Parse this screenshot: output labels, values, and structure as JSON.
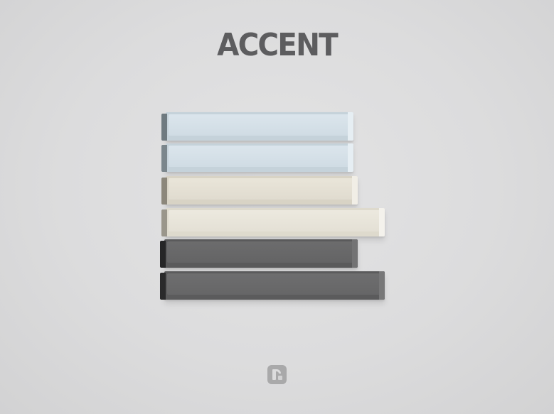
{
  "title": "ACCENT",
  "keycaps": [
    {
      "name": "light-blue-spacebar-1",
      "color": "#d0dce4"
    },
    {
      "name": "light-blue-spacebar-2",
      "color": "#d0dce4"
    },
    {
      "name": "cream-spacebar-1",
      "color": "#e0dbcf"
    },
    {
      "name": "cream-spacebar-2",
      "color": "#e4e0d5"
    },
    {
      "name": "dark-gray-spacebar-1",
      "color": "#646465"
    },
    {
      "name": "dark-gray-spacebar-2",
      "color": "#666667"
    }
  ],
  "logo": {
    "icon": "brand-r-logo-icon",
    "color": "#a9a9aa"
  },
  "colors": {
    "background": "#dcdcdd",
    "title": "#5d5d5f"
  }
}
